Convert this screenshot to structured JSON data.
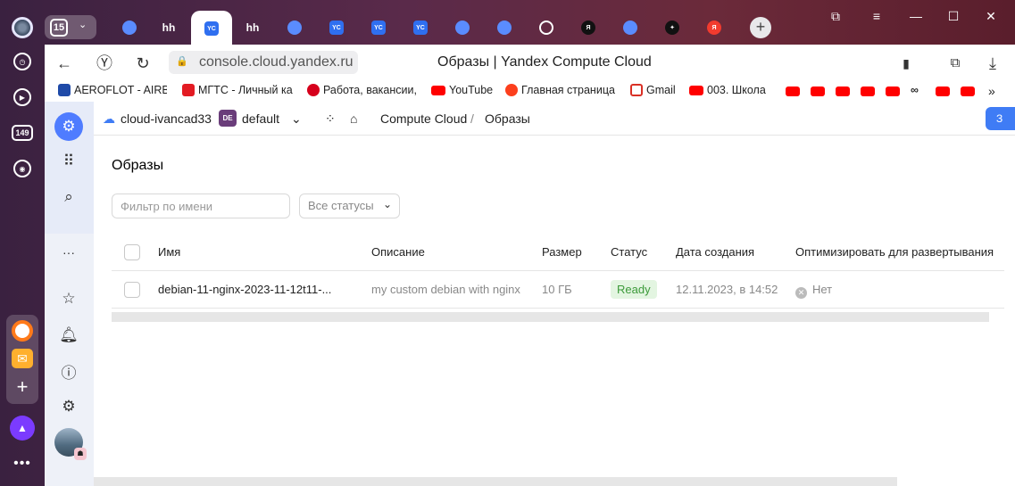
{
  "browser": {
    "tab_count": "15",
    "new_tab_label": "+",
    "rail": {
      "item_149": "149",
      "more": "•••"
    },
    "window_controls": {
      "bookmarks": "⧉",
      "menu": "≡",
      "minimize": "—",
      "maximize": "☐",
      "close": "✕"
    },
    "tabs": [
      {
        "icon": "blue-compass-icon",
        "text": ""
      },
      {
        "icon": "hh-icon",
        "text": "hh"
      },
      {
        "icon": "yc-icon",
        "text": "YC",
        "active": true
      },
      {
        "icon": "hh-icon",
        "text": "hh"
      },
      {
        "icon": "blue-compass-icon",
        "text": ""
      },
      {
        "icon": "yc-icon",
        "text": "YC"
      },
      {
        "icon": "yc-icon",
        "text": "YC"
      },
      {
        "icon": "yc-icon",
        "text": "YC"
      },
      {
        "icon": "blue-compass-icon",
        "text": ""
      },
      {
        "icon": "blue-compass-icon",
        "text": ""
      },
      {
        "icon": "smile-icon",
        "text": ""
      },
      {
        "icon": "yandex-icon",
        "text": "Я"
      },
      {
        "icon": "blue-compass-icon",
        "text": ""
      },
      {
        "icon": "star-icon",
        "text": "✦"
      },
      {
        "icon": "yandex-red-icon",
        "text": "Я"
      }
    ],
    "address": "console.cloud.yandex.ru",
    "page_title": "Образы | Yandex Compute Cloud",
    "bookmarks": [
      {
        "label": "AEROFLOT - AIRBUS",
        "icon": "aeroflot-icon"
      },
      {
        "label": "МГТС - Личный ка",
        "icon": "mgts-icon"
      },
      {
        "label": "Работа, вакансии,",
        "icon": "hh-icon"
      },
      {
        "label": "YouTube",
        "icon": "youtube-icon"
      },
      {
        "label": "Главная страница",
        "icon": "yandex-icon"
      },
      {
        "label": "Gmail",
        "icon": "gmail-icon"
      },
      {
        "label": "003. Школа",
        "icon": "youtube-icon"
      }
    ],
    "more_bookmarks": "»"
  },
  "console": {
    "cloud_name": "cloud-ivancad33",
    "folder_badge": "DE",
    "folder_name": "default",
    "breadcrumb": [
      "Compute Cloud",
      "Образы"
    ],
    "breadcrumb_separator": "/",
    "create_button_label": "З",
    "page_heading": "Образы",
    "filter_placeholder": "Фильтр по имени",
    "status_select": "Все статусы",
    "columns": [
      "Имя",
      "Описание",
      "Размер",
      "Статус",
      "Дата создания",
      "Оптимизировать для развертывания"
    ],
    "rows": [
      {
        "name": "debian-11-nginx-2023-11-12t11-...",
        "description": "my custom debian with nginx",
        "size": "10 ГБ",
        "status": "Ready",
        "created": "12.11.2023, в 14:52",
        "optimize": "Нет"
      }
    ]
  },
  "colors": {
    "accent": "#3f7cf5",
    "ready_bg": "#e3f5e1",
    "ready_text": "#3c9a3a"
  }
}
